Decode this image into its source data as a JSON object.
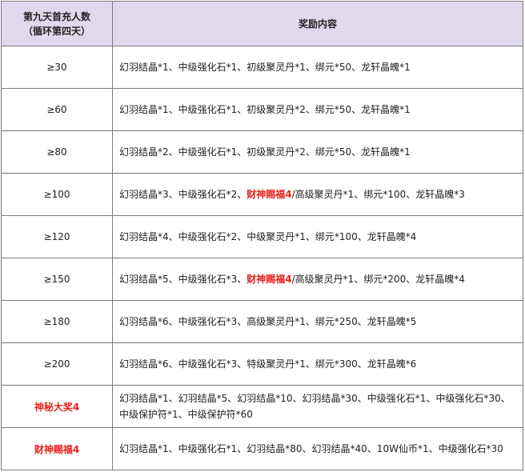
{
  "header": {
    "col1_line1": "第九天首充人数",
    "col1_line2": "（循环第四天）",
    "col2": "奖励内容"
  },
  "rows": [
    {
      "condition": "≥30",
      "condition_red": false,
      "reward": [
        {
          "text": "幻羽结晶*1、中级强化石*1、初级聚灵丹*1、绑元*50、龙轩晶魄*1",
          "highlight": false
        }
      ]
    },
    {
      "condition": "≥60",
      "condition_red": false,
      "reward": [
        {
          "text": "幻羽结晶*1、中级强化石*1、初级聚灵丹*2、绑元*50、龙轩晶魄*1",
          "highlight": false
        }
      ]
    },
    {
      "condition": "≥80",
      "condition_red": false,
      "reward": [
        {
          "text": "幻羽结晶*2、中级强化石*1、初级聚灵丹*2、绑元*50、龙轩晶魄*1",
          "highlight": false
        }
      ]
    },
    {
      "condition": "≥100",
      "condition_red": false,
      "reward": [
        {
          "text": "幻羽结晶*3、中级强化石*2、",
          "highlight": false
        },
        {
          "text": "财神赐福4",
          "highlight": true
        },
        {
          "text": "/高级聚灵丹*1、绑元*100、龙轩晶魄*3",
          "highlight": false
        }
      ]
    },
    {
      "condition": "≥120",
      "condition_red": false,
      "reward": [
        {
          "text": "幻羽结晶*4、中级强化石*2、中级聚灵丹*1、绑元*100、龙轩晶魄*4",
          "highlight": false
        }
      ]
    },
    {
      "condition": "≥150",
      "condition_red": false,
      "reward": [
        {
          "text": "幻羽结晶*5、中级强化石*3、",
          "highlight": false
        },
        {
          "text": "财神赐福4",
          "highlight": true
        },
        {
          "text": "/高级聚灵丹*1、绑元*200、龙轩晶魄*4",
          "highlight": false
        }
      ]
    },
    {
      "condition": "≥180",
      "condition_red": false,
      "reward": [
        {
          "text": "幻羽结晶*6、中级强化石*3、高级聚灵丹*1、绑元*250、龙轩晶魄*5",
          "highlight": false
        }
      ]
    },
    {
      "condition": "≥200",
      "condition_red": false,
      "reward": [
        {
          "text": "幻羽结晶*6、中级强化石*3、特级聚灵丹*1、绑元*300、龙轩晶魄*6",
          "highlight": false
        }
      ]
    },
    {
      "condition": "神秘大奖4",
      "condition_red": true,
      "reward": [
        {
          "text": "幻羽结晶*1、幻羽结晶*5、幻羽结晶*10、幻羽结晶*30、中级强化石*1、中级强化石*30、中级保护符*1、中级保护符*60",
          "highlight": false
        }
      ]
    },
    {
      "condition": "财神赐福4",
      "condition_red": true,
      "reward": [
        {
          "text": "幻羽结晶*1、中级强化石*1、幻羽结晶*80、幻羽结晶*40、10W仙币*1、中级强化石*30",
          "highlight": false
        }
      ]
    }
  ]
}
